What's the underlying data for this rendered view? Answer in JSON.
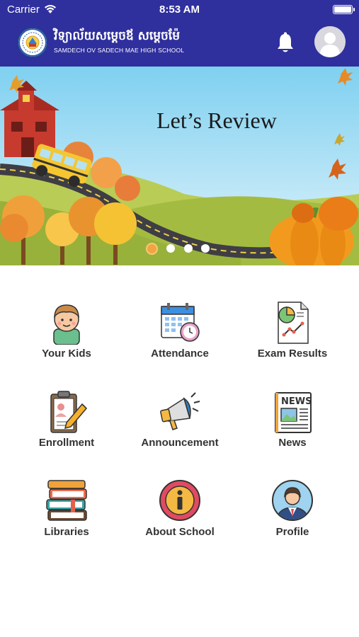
{
  "status_bar": {
    "carrier": "Carrier",
    "time": "8:53 AM"
  },
  "header": {
    "school_name_kh": "វិទ្យាល័យសម្តេចឪ សម្តេចម៉ែ",
    "school_name_en": "SAMDECH OV SADECH MAE HIGH SCHOOL",
    "background_color": "#2f2f9e"
  },
  "banner": {
    "title": "Let’s Review",
    "slide_count": 4,
    "active_slide": 1
  },
  "menu": {
    "items": [
      {
        "label": "Your Kids",
        "icon": "kid-icon"
      },
      {
        "label": "Attendance",
        "icon": "calendar-clock-icon"
      },
      {
        "label": "Exam Results",
        "icon": "report-chart-icon"
      },
      {
        "label": "Enrollment",
        "icon": "clipboard-pen-icon"
      },
      {
        "label": "Announcement",
        "icon": "megaphone-icon"
      },
      {
        "label": "News",
        "icon": "newspaper-icon"
      },
      {
        "label": "Libraries",
        "icon": "books-icon"
      },
      {
        "label": "About School",
        "icon": "info-icon"
      },
      {
        "label": "Profile",
        "icon": "businessman-icon"
      }
    ]
  }
}
